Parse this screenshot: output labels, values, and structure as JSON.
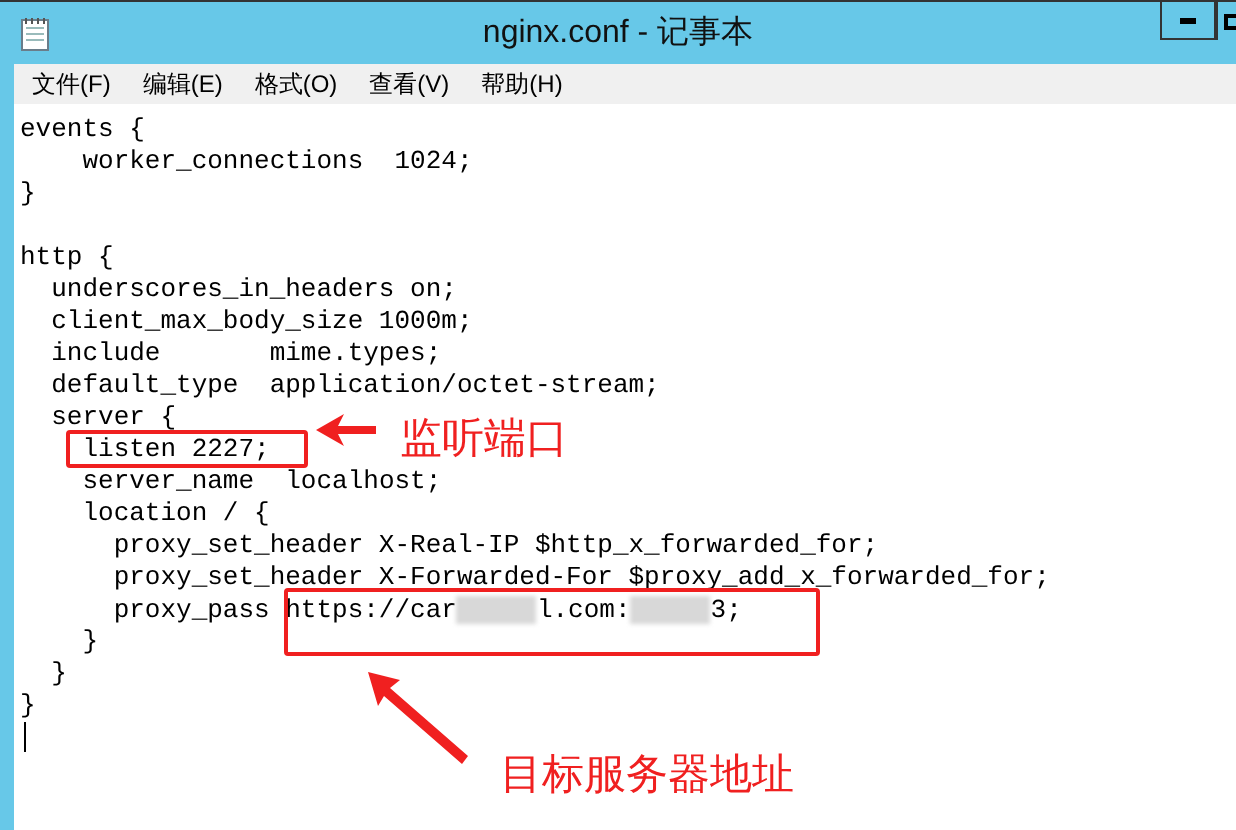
{
  "window": {
    "title": "nginx.conf - 记事本"
  },
  "menu": [
    "文件(F)",
    "编辑(E)",
    "格式(O)",
    "查看(V)",
    "帮助(H)"
  ],
  "lines": [
    {
      "kind": "code",
      "segments": [
        {
          "text": "events {"
        }
      ]
    },
    {
      "kind": "code",
      "segments": [
        {
          "text": "    worker_connections  1024;"
        }
      ]
    },
    {
      "kind": "code",
      "segments": [
        {
          "text": "}"
        }
      ]
    },
    {
      "kind": "blank"
    },
    {
      "kind": "code",
      "segments": [
        {
          "text": "http {"
        }
      ]
    },
    {
      "kind": "code",
      "segments": [
        {
          "text": "  underscores_in_headers on;"
        }
      ]
    },
    {
      "kind": "code",
      "segments": [
        {
          "text": "  client_max_body_size 1000m;"
        }
      ]
    },
    {
      "kind": "code",
      "segments": [
        {
          "text": "  include       mime.types;"
        }
      ]
    },
    {
      "kind": "code",
      "segments": [
        {
          "text": "  default_type  application/octet-stream;"
        }
      ]
    },
    {
      "kind": "code",
      "segments": [
        {
          "text": "  server {"
        }
      ]
    },
    {
      "kind": "code",
      "segments": [
        {
          "text": "    listen 2227;"
        }
      ]
    },
    {
      "kind": "code",
      "segments": [
        {
          "text": "    server_name  localhost;"
        }
      ]
    },
    {
      "kind": "code",
      "segments": [
        {
          "text": "    location / {"
        }
      ]
    },
    {
      "kind": "code",
      "segments": [
        {
          "text": "      proxy_set_header X-Real-IP $http_x_forwarded_for;"
        }
      ]
    },
    {
      "kind": "code",
      "segments": [
        {
          "text": "      proxy_set_header X-Forwarded-For $proxy_add_x_forwarded_for;"
        }
      ]
    },
    {
      "kind": "code",
      "segments": [
        {
          "text": "      proxy_pass https://car"
        },
        {
          "kind": "redacted"
        },
        {
          "text": "l.com:"
        },
        {
          "kind": "redacted"
        },
        {
          "text": "3;"
        }
      ]
    },
    {
      "kind": "code",
      "segments": [
        {
          "text": "    }"
        }
      ]
    },
    {
      "kind": "code",
      "segments": [
        {
          "text": "  }"
        }
      ]
    },
    {
      "kind": "code",
      "segments": [
        {
          "text": "}"
        }
      ]
    }
  ],
  "annotations": [
    {
      "label": "监听端口"
    },
    {
      "label": "目标服务器地址"
    }
  ]
}
